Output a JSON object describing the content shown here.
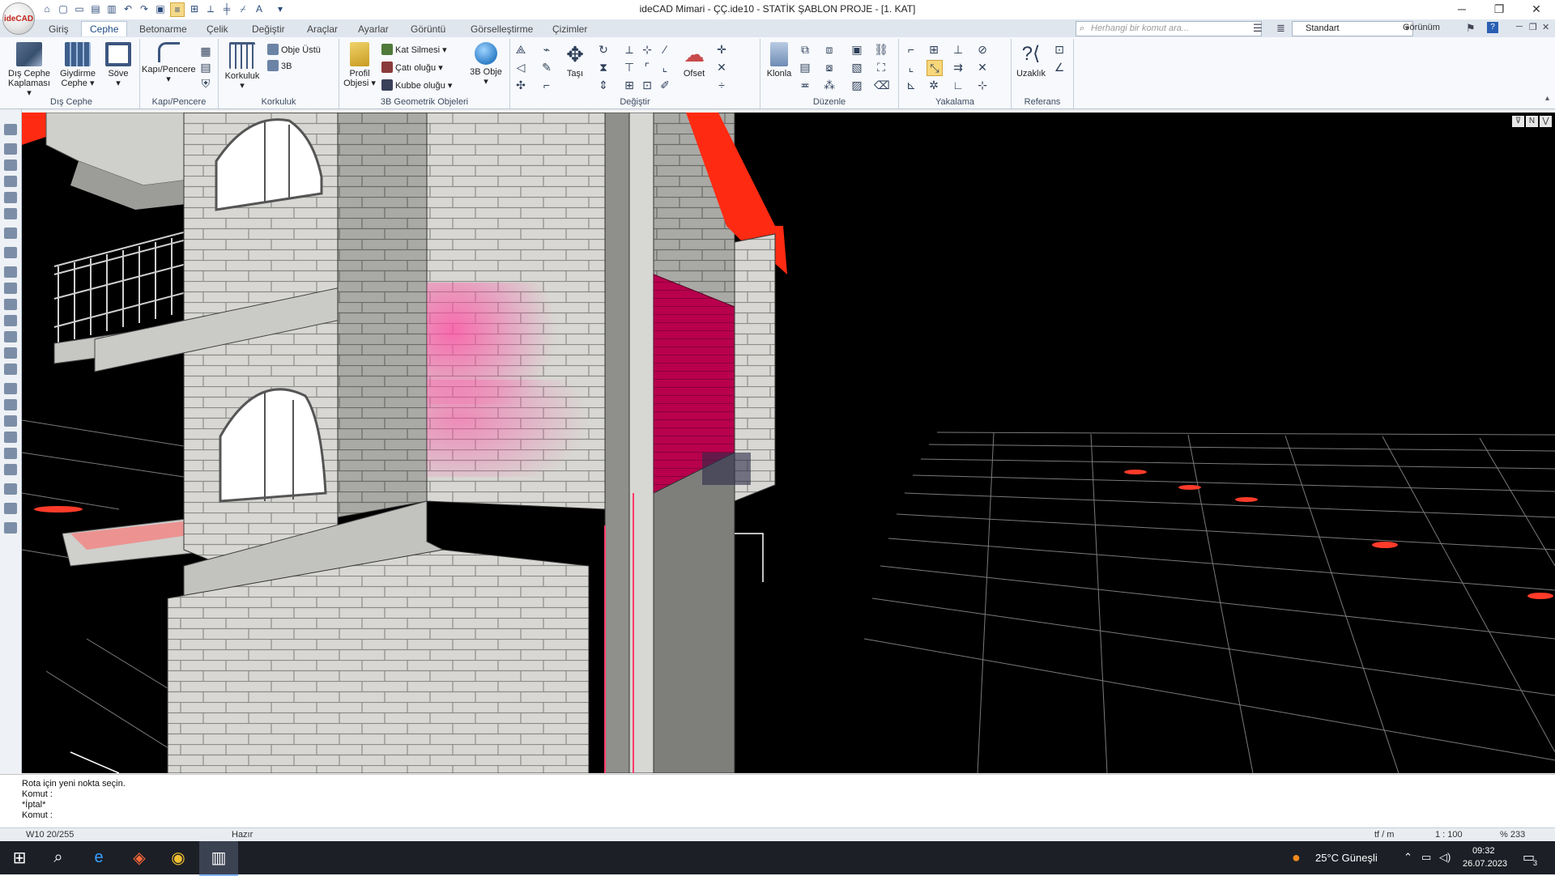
{
  "window": {
    "title": "ideCAD Mimari - ÇÇ.ide10 - STATİK ŞABLON PROJE - [1. KAT]",
    "app_logo_text": "ideCAD"
  },
  "tabs": [
    {
      "label": "Giriş",
      "active": false
    },
    {
      "label": "Cephe",
      "active": true
    },
    {
      "label": "Betonarme",
      "active": false
    },
    {
      "label": "Çelik",
      "active": false
    },
    {
      "label": "Değiştir",
      "active": false
    },
    {
      "label": "Araçlar",
      "active": false
    },
    {
      "label": "Ayarlar",
      "active": false
    },
    {
      "label": "Görüntü",
      "active": false
    },
    {
      "label": "Görselleştirme",
      "active": false
    },
    {
      "label": "Çizimler",
      "active": false
    }
  ],
  "search": {
    "placeholder": "Herhangi bir komut ara..."
  },
  "style_select": {
    "value": "Standart"
  },
  "view_menu": {
    "label": "Görünüm"
  },
  "ribbon": {
    "dis_cephe": {
      "group_label": "Dış Cephe",
      "dis_cephe_kaplamasi": "Dış Cephe Kaplaması",
      "giydirme_cephe": "Giydirme Cephe",
      "sove": "Söve"
    },
    "kapi_pencere": {
      "group_label": "Kapı/Pencere",
      "kapi_pencere": "Kapı/Pencere"
    },
    "korkuluk": {
      "group_label": "Korkuluk",
      "korkuluk": "Korkuluk",
      "obje_ustu": "Obje Üstü",
      "uc_b": "3B"
    },
    "geometrik": {
      "group_label": "3B Geometrik Objeleri",
      "profil_objesi": "Profil Objesi",
      "kat_silmesi": "Kat Silmesi",
      "cati_olugu": "Çatı oluğu",
      "kubbe_olugu": "Kubbe oluğu",
      "obje_3b": "3B Obje"
    },
    "degistir": {
      "group_label": "Değiştir",
      "tasi": "Taşı",
      "ofset": "Ofset"
    },
    "duzenle": {
      "group_label": "Düzenle",
      "klonla": "Klonla"
    },
    "yakalama": {
      "group_label": "Yakalama"
    },
    "referans": {
      "group_label": "Referans",
      "uzaklik": "Uzaklık"
    }
  },
  "command_area": {
    "lines": [
      "Rota için yeni nokta seçin.",
      "Komut :",
      "*İptal*",
      "Komut :"
    ]
  },
  "status_bar": {
    "left": "W10 20/255",
    "state": "Hazır",
    "unit": "tf / m",
    "scale": "1 : 100",
    "zoom": "% 233"
  },
  "taskbar": {
    "weather": "25°C  Güneşli",
    "time": "09:32",
    "date": "26.07.2023",
    "notification_count": "3"
  },
  "colors": {
    "roof_red": "#ff2a12",
    "magenta_wall": "#b8004d",
    "brick_light": "#d9d9d6",
    "viewport_bg": "#000000"
  }
}
